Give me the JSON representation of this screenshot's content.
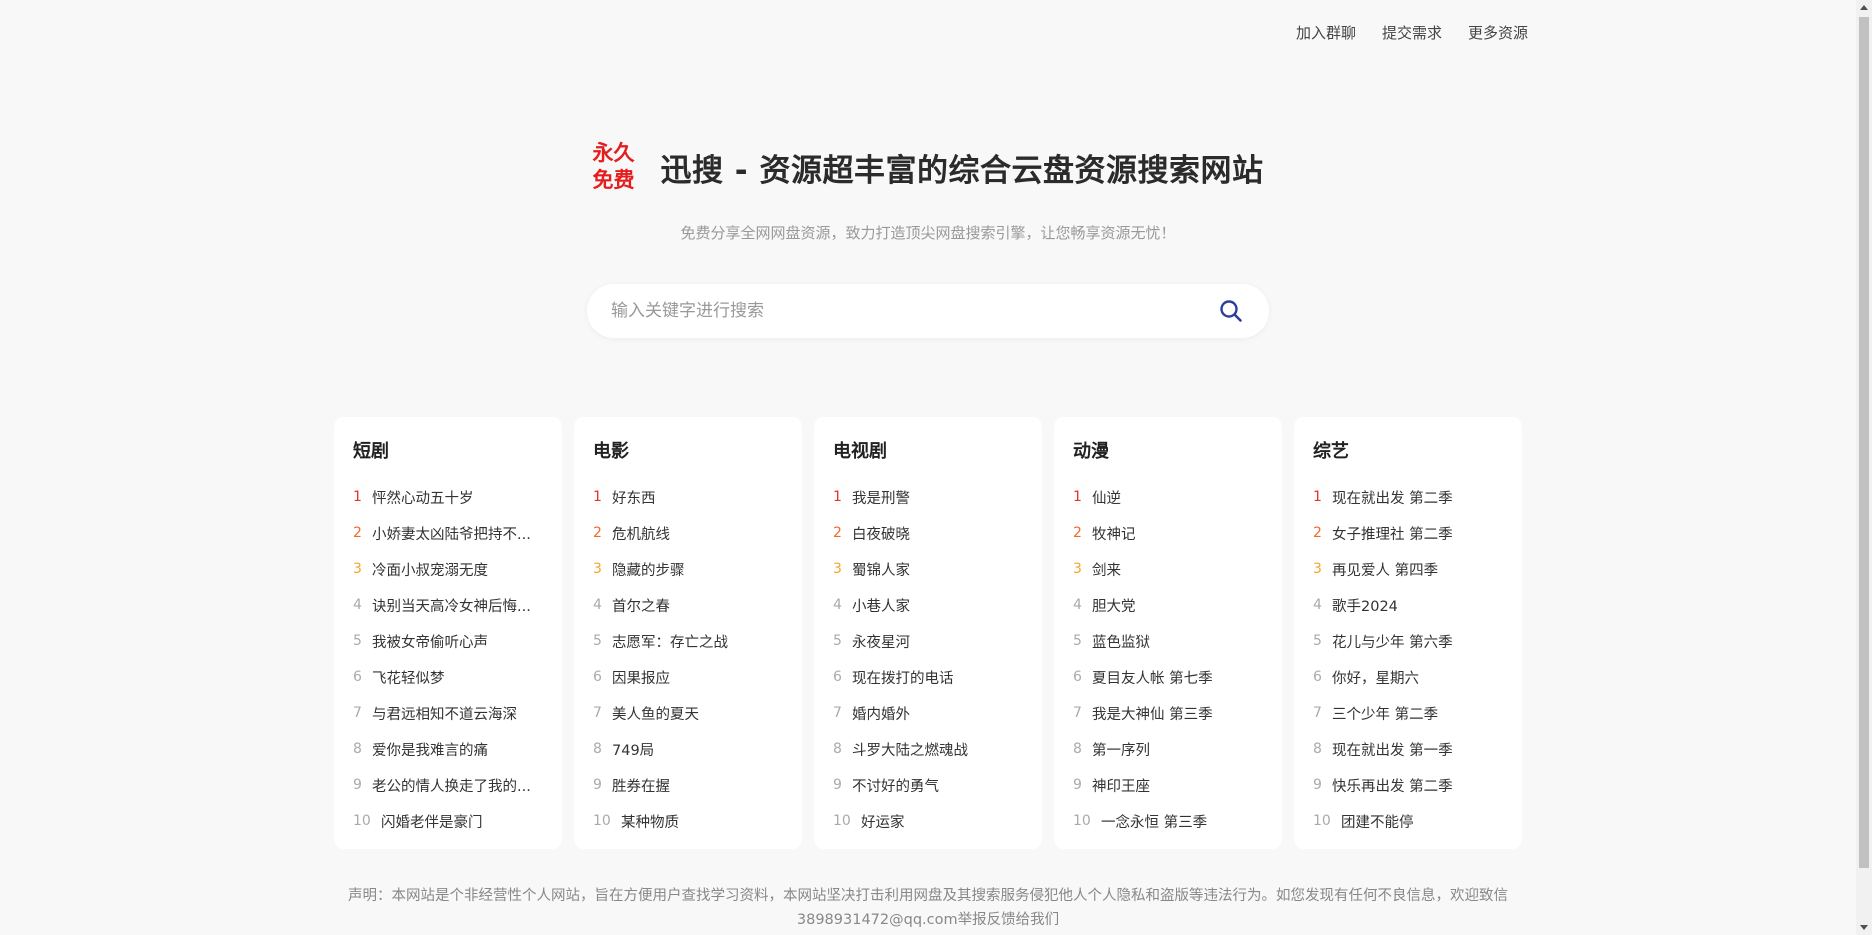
{
  "nav": {
    "items": [
      "加入群聊",
      "提交需求",
      "更多资源"
    ]
  },
  "hero": {
    "badge_line1": "永久",
    "badge_line2": "免费",
    "title": "迅搜 - 资源超丰富的综合云盘资源搜索网站"
  },
  "subtitle": "免费分享全网网盘资源，致力打造顶尖网盘搜索引擎，让您畅享资源无忧！",
  "search": {
    "placeholder": "输入关键字进行搜索",
    "icon": "search-icon",
    "icon_color": "#2c3e9e"
  },
  "colors": {
    "rank1": "#e5312f",
    "rank2": "#f06a20",
    "rank3": "#f5a623",
    "rank_other": "#aaaaaa"
  },
  "categories": [
    {
      "title": "短剧",
      "items": [
        "怦然心动五十岁",
        "小娇妻太凶陆爷把持不...",
        "冷面小叔宠溺无度",
        "诀别当天高冷女神后悔...",
        "我被女帝偷听心声",
        "飞花轻似梦",
        "与君远相知不道云海深",
        "爱你是我难言的痛",
        "老公的情人换走了我的...",
        "闪婚老伴是豪门"
      ]
    },
    {
      "title": "电影",
      "items": [
        "好东西",
        "危机航线",
        "隐藏的步骤",
        "首尔之春",
        "志愿军：存亡之战",
        "因果报应",
        "美人鱼的夏天",
        "749局",
        "胜券在握",
        "某种物质"
      ]
    },
    {
      "title": "电视剧",
      "items": [
        "我是刑警",
        "白夜破晓",
        "蜀锦人家",
        "小巷人家",
        "永夜星河",
        "现在拨打的电话",
        "婚内婚外",
        "斗罗大陆之燃魂战",
        "不讨好的勇气",
        "好运家"
      ]
    },
    {
      "title": "动漫",
      "items": [
        "仙逆",
        "牧神记",
        "剑来",
        "胆大党",
        "蓝色监狱",
        "夏目友人帐 第七季",
        "我是大神仙 第三季",
        "第一序列",
        "神印王座",
        "一念永恒 第三季"
      ]
    },
    {
      "title": "综艺",
      "items": [
        "现在就出发 第二季",
        "女子推理社 第二季",
        "再见爱人 第四季",
        "歌手2024",
        "花儿与少年 第六季",
        "你好，星期六",
        "三个少年 第二季",
        "现在就出发 第一季",
        "快乐再出发 第二季",
        "团建不能停"
      ]
    }
  ],
  "footer": {
    "line1": "声明：本网站是个非经营性个人网站，旨在方便用户查找学习资料，本网站坚决打击利用网盘及其搜索服务侵犯他人个人隐私和盗版等违法行为。如您发现有任何不良信息，欢迎致信",
    "line2": "3898931472@qq.com举报反馈给我们"
  }
}
